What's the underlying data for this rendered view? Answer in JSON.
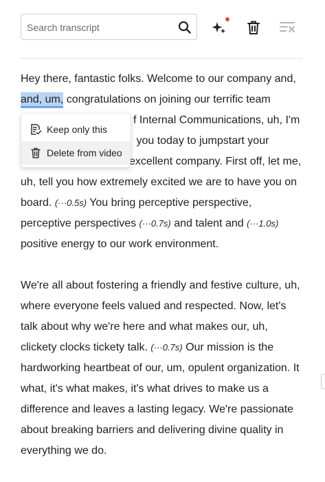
{
  "search": {
    "placeholder": "Search transcript"
  },
  "toolbar": {
    "ai_button_icon": "sparkles-icon",
    "delete_button_icon": "trash-icon",
    "clear_button_icon": "clear-format-icon",
    "notification_color": "#e8434f"
  },
  "transcript": {
    "p1": {
      "s1": "Hey there, fantastic folks. Welcome to our company and, ",
      "selected": "and, um,",
      "s2": " congratulations on joining our terrific team",
      "s3": "f Internal Communications, uh, I'm",
      "s4": " you today to jumpstart your",
      "s5": "excellent company. First off, let me, uh, tell you how extremely excited we are to have you on board.",
      "pause1": "(···0.5s)",
      "s6": "You bring perceptive perspective, perceptive perspectives",
      "pause2": "(···0.7s)",
      "s7": "and talent and",
      "pause3": "(···1.0s)",
      "s8": "positive energy to our work environment."
    },
    "p2": {
      "s1": "We're all about fostering a friendly and festive culture, uh, where everyone feels valued and respected. Now, let's talk about why we're here and what makes our, uh, clickety clocks tickety talk.",
      "pause1": "(···0.7s)",
      "s2": "Our mission is the hardworking heartbeat of our, um, opulent organization. It what, it's what makes, it's what drives to make us a difference and leaves a lasting legacy. We're passionate about breaking barriers and delivering divine quality in everything we do."
    }
  },
  "context_menu": {
    "items": [
      {
        "label": "Keep only this",
        "icon": "keep-only-icon"
      },
      {
        "label": "Delete from video",
        "icon": "trash-icon"
      }
    ]
  },
  "colors": {
    "selection_bg": "#b8d4f3",
    "selection_underline": "#6da4e6"
  }
}
